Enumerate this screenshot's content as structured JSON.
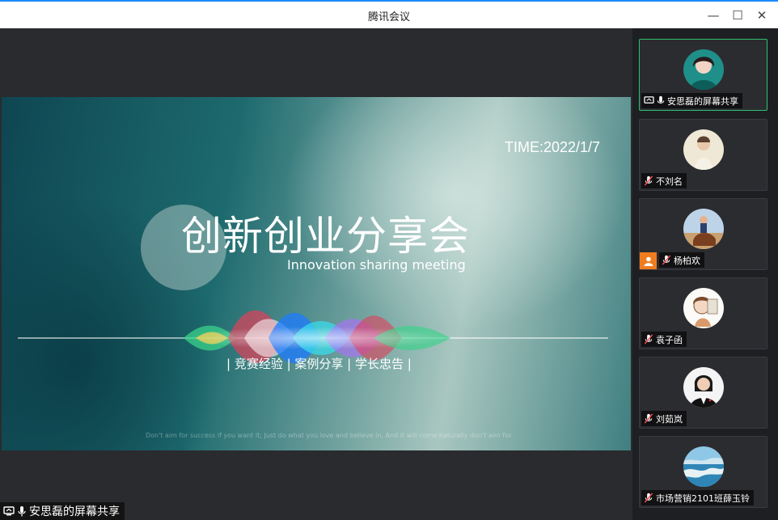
{
  "window": {
    "title": "腾讯会议",
    "minimize_glyph": "—",
    "maximize_glyph": "☐",
    "close_glyph": "✕"
  },
  "slide": {
    "time": "TIME:2022/1/7",
    "title_cn": "创新创业分享会",
    "title_en": "Innovation sharing meeting",
    "topics": "| 竞赛经验 | 案例分享 | 学长忠告 |",
    "motto": "Don't aim for success if you want it; Just do what you love and believe in, And it will come naturally don't aim for."
  },
  "share_status": {
    "label": "安思磊的屏幕共享",
    "icons": [
      "screen-share-icon",
      "mic-icon"
    ]
  },
  "participants": [
    {
      "name": "安思磊的屏幕共享",
      "active": true,
      "mic": "on",
      "sharing": true
    },
    {
      "name": "不刘名",
      "active": false,
      "mic": "muted"
    },
    {
      "name": "杨柏欢",
      "active": false,
      "mic": "muted",
      "host": true
    },
    {
      "name": "袁子函",
      "active": false,
      "mic": "muted"
    },
    {
      "name": "刘茹岚",
      "active": false,
      "mic": "muted"
    },
    {
      "name": "市场营销2101班薛玉铃",
      "active": false,
      "mic": "muted"
    }
  ],
  "colors": {
    "accent_border": "#2fbf71",
    "host_badge": "#f07c1e",
    "titlebar_top": "#1a8cff"
  }
}
